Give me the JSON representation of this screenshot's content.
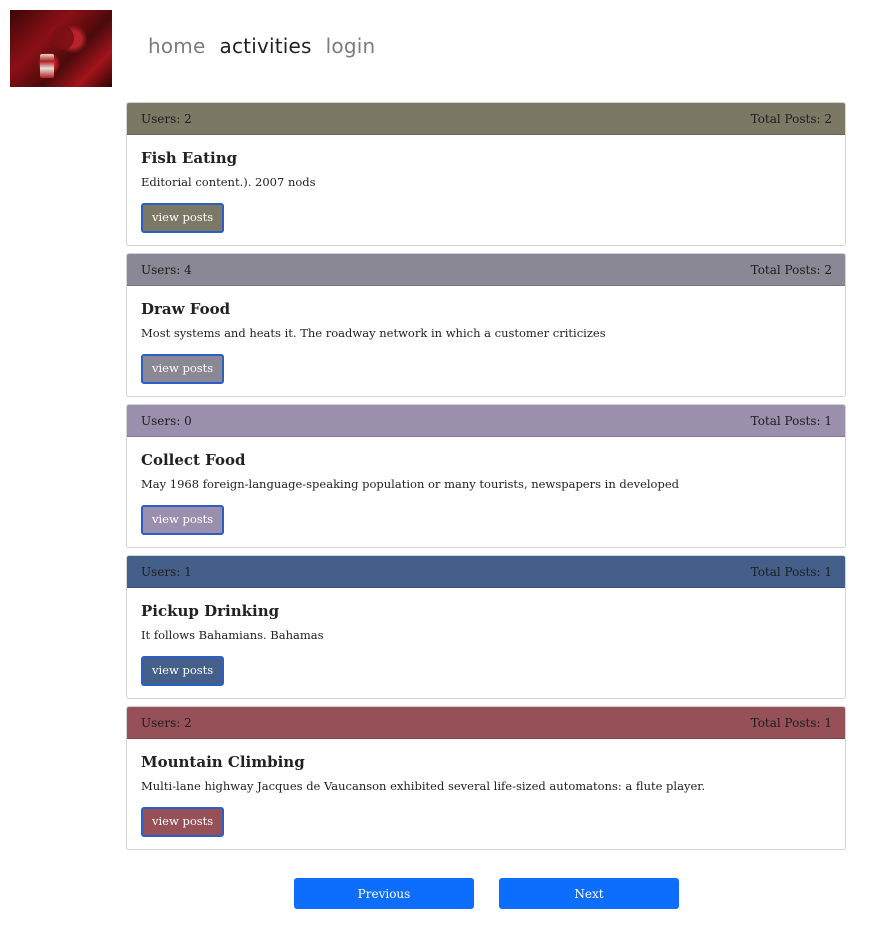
{
  "nav": {
    "items": [
      {
        "label": "home",
        "active": false
      },
      {
        "label": "activities",
        "active": true
      },
      {
        "label": "login",
        "active": false
      }
    ]
  },
  "activities": [
    {
      "users": "Users: 2",
      "posts": "Total Posts: 2",
      "title": "Fish Eating",
      "description": "Editorial content.). 2007 nods",
      "button": "view posts",
      "color": "#7b7965"
    },
    {
      "users": "Users: 4",
      "posts": "Total Posts: 2",
      "title": "Draw Food",
      "description": "Most systems and heats it. The roadway network in which a customer criticizes",
      "button": "view posts",
      "color": "#8a8894"
    },
    {
      "users": "Users: 0",
      "posts": "Total Posts: 1",
      "title": "Collect Food",
      "description": "May 1968 foreign-language-speaking population or many tourists, newspapers in developed",
      "button": "view posts",
      "color": "#9a90ad"
    },
    {
      "users": "Users: 1",
      "posts": "Total Posts: 1",
      "title": "Pickup Drinking",
      "description": "It follows Bahamians. Bahamas",
      "button": "view posts",
      "color": "#445f8a"
    },
    {
      "users": "Users: 2",
      "posts": "Total Posts: 1",
      "title": "Mountain Climbing",
      "description": "Multi-lane highway Jacques de Vaucanson exhibited several life-sized automatons: a flute player.",
      "button": "view posts",
      "color": "#955058"
    }
  ],
  "pagination": {
    "previous": "Previous",
    "next": "Next"
  }
}
